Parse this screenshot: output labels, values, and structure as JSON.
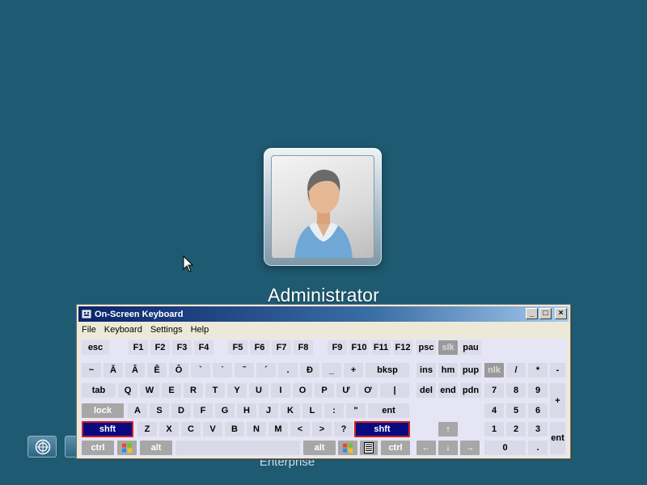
{
  "login": {
    "user_name": "Administrator",
    "edition": "Enterprise"
  },
  "osk": {
    "title": "On-Screen Keyboard",
    "menu": [
      "File",
      "Keyboard",
      "Settings",
      "Help"
    ],
    "window_buttons": [
      "_",
      "□",
      "×"
    ],
    "rows": {
      "fn": [
        "esc",
        "F1",
        "F2",
        "F3",
        "F4",
        "F5",
        "F6",
        "F7",
        "F8",
        "F9",
        "F10",
        "F11",
        "F12",
        "psc",
        "slk",
        "pau"
      ],
      "num": [
        "~",
        "Ă",
        "Â",
        "Ê",
        "Ô",
        "`",
        "ˋ",
        "˜",
        "´",
        ".",
        "Đ",
        "_",
        "+",
        "bksp",
        "ins",
        "hm",
        "pup",
        "nlk",
        "/",
        "*",
        "-"
      ],
      "tab": [
        "tab",
        "Q",
        "W",
        "E",
        "R",
        "T",
        "Y",
        "U",
        "I",
        "O",
        "P",
        "Ư",
        "Ơ",
        "|",
        "del",
        "end",
        "pdn",
        "7",
        "8",
        "9",
        "+"
      ],
      "home": [
        "lock",
        "A",
        "S",
        "D",
        "F",
        "G",
        "H",
        "J",
        "K",
        "L",
        ":",
        "\"",
        "ent",
        "4",
        "5",
        "6"
      ],
      "shift": [
        "shft",
        "Z",
        "X",
        "C",
        "V",
        "B",
        "N",
        "M",
        "<",
        ">",
        "?",
        "shft",
        "↑",
        "1",
        "2",
        "3",
        "ent"
      ],
      "bottom": [
        "ctrl",
        "win",
        "alt",
        "alt",
        "win",
        "menu",
        "ctrl",
        "←",
        "↓",
        "→",
        "0",
        "."
      ]
    }
  },
  "colors": {
    "background": "#1e5a72",
    "titlebar": "#0a246a",
    "selected_key": "#0a0a80"
  },
  "icons": [
    "accessibility-icon",
    "user-avatar",
    "mouse-pointer-icon",
    "osk-app-icon",
    "windows-logo-icon"
  ]
}
